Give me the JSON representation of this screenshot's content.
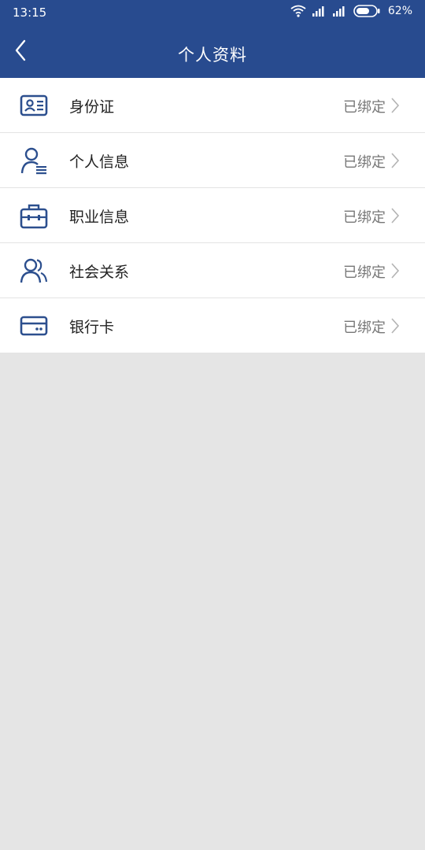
{
  "status_bar": {
    "time": "13:15",
    "battery": "62%",
    "icons": [
      "wifi-icon",
      "signal-icon",
      "signal-icon",
      "battery-icon"
    ]
  },
  "header": {
    "title": "个人资料",
    "back_icon": "chevron-left-icon"
  },
  "colors": {
    "header_bg": "#284b8f",
    "icon_blue": "#2c4f8e",
    "page_bg": "#e5e5e5"
  },
  "items": [
    {
      "label": "身份证",
      "status": "已绑定",
      "icon": "id-card-icon"
    },
    {
      "label": "个人信息",
      "status": "已绑定",
      "icon": "person-info-icon"
    },
    {
      "label": "职业信息",
      "status": "已绑定",
      "icon": "briefcase-icon"
    },
    {
      "label": "社会关系",
      "status": "已绑定",
      "icon": "people-icon"
    },
    {
      "label": "银行卡",
      "status": "已绑定",
      "icon": "bank-card-icon"
    }
  ]
}
